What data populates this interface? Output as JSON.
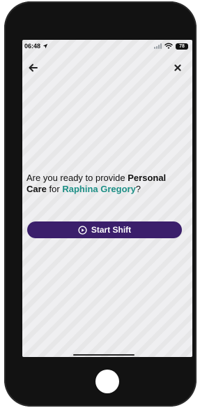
{
  "status_bar": {
    "time": "06:48",
    "battery": "78"
  },
  "icons": {
    "location": "location-arrow-icon",
    "signal": "signal-bars-icon",
    "wifi": "wifi-icon",
    "battery": "battery-icon",
    "back": "arrow-left-icon",
    "close": "close-icon",
    "play": "play-circle-icon"
  },
  "prompt": {
    "part1": "Are you ready to provide ",
    "service": "Personal Care",
    "part2": " for ",
    "client": "Raphina Gregory",
    "part3": "?"
  },
  "start_button": {
    "label": "Start Shift"
  },
  "colors": {
    "button_bg": "#3b1f6b",
    "client_name": "#1d8f86",
    "phone_body": "#121212",
    "screen_bg": "#efeff1"
  }
}
